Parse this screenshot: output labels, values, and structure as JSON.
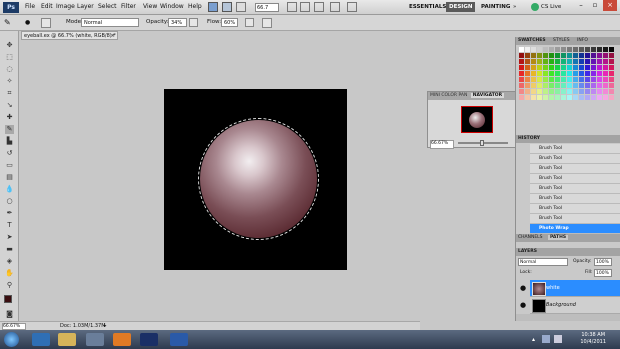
{
  "menubar": {
    "logo": "Ps",
    "menus": [
      "File",
      "Edit",
      "Image",
      "Layer",
      "Select",
      "Filter",
      "View",
      "Window",
      "Help"
    ],
    "zoom": "66.7",
    "workspaces": [
      "ESSENTIALS",
      "DESIGN",
      "PAINTING"
    ],
    "cslive": "CS Live"
  },
  "options": {
    "mode_label": "Mode:",
    "mode_value": "Normal",
    "opacity_label": "Opacity:",
    "opacity_value": "34%",
    "flow_label": "Flow:",
    "flow_value": "60%"
  },
  "document": {
    "tab_title": "eyeball.ex @ 66.7% (white, RGB/8) *",
    "zoom": "66.67%",
    "doc_info": "Doc: 1.03M/1.37M"
  },
  "navigator": {
    "tabs": [
      "MINI COLOR PAN",
      "NAVIGATOR"
    ],
    "zoom": "66.67%"
  },
  "swatches": {
    "tabs": [
      "SWATCHES",
      "STYLES",
      "INFO"
    ]
  },
  "history": {
    "tab": "HISTORY",
    "items": [
      "Brush Tool",
      "Brush Tool",
      "Brush Tool",
      "Brush Tool",
      "Brush Tool",
      "Brush Tool",
      "Brush Tool",
      "Brush Tool",
      "Photo Wrap"
    ],
    "selected_index": 8
  },
  "channels": {
    "tabs": [
      "CHANNELS",
      "PATHS"
    ]
  },
  "layers": {
    "tab": "LAYERS",
    "blend": "Normal",
    "opacity_label": "Opacity:",
    "opacity_value": "100%",
    "lock_label": "Lock:",
    "fill_label": "Fill:",
    "fill_value": "100%",
    "items": [
      {
        "name": "white",
        "selected": true
      },
      {
        "name": "Background",
        "selected": false
      }
    ]
  },
  "taskbar": {
    "time": "10:38 AM",
    "date": "10/4/2011"
  },
  "colors": {
    "accent": "#2b8dff"
  }
}
